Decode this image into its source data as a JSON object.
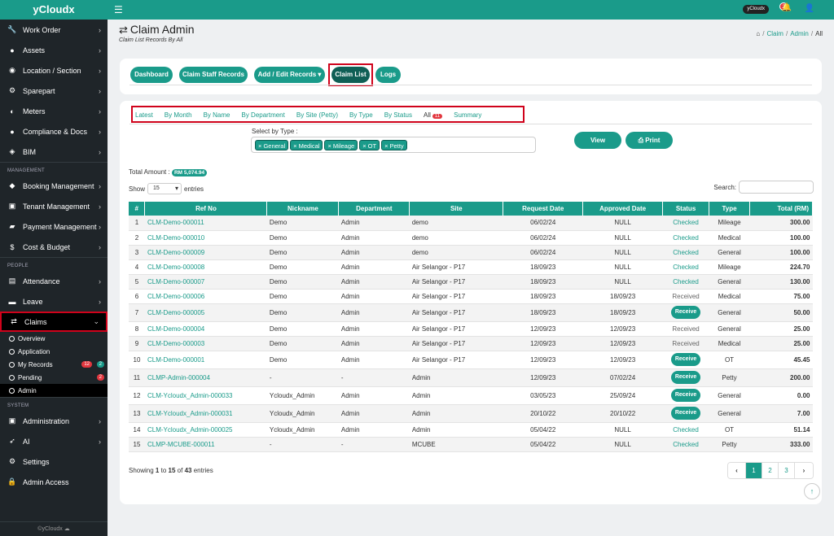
{
  "brand": "yCloudx",
  "topbar": {
    "user_label": "yCloudx",
    "notif_count": "2"
  },
  "sidebar": {
    "items_top": [
      {
        "label": "Work Order",
        "icon": "wrench-icon",
        "glyph": "🔧"
      },
      {
        "label": "Assets",
        "icon": "tag-icon",
        "glyph": "●"
      },
      {
        "label": "Location / Section",
        "icon": "globe-icon",
        "glyph": "◉"
      },
      {
        "label": "Sparepart",
        "icon": "cog-icon",
        "glyph": "⚙"
      },
      {
        "label": "Meters",
        "icon": "dashboard-icon",
        "glyph": "◐"
      },
      {
        "label": "Compliance & Docs",
        "icon": "shield-icon",
        "glyph": "●"
      },
      {
        "label": "BIM",
        "icon": "cube-icon",
        "glyph": "◈"
      }
    ],
    "section_management": "MANAGEMENT",
    "items_management": [
      {
        "label": "Booking Management",
        "icon": "ticket-icon",
        "glyph": "◆"
      },
      {
        "label": "Tenant Management",
        "icon": "building-icon",
        "glyph": "▣"
      },
      {
        "label": "Payment Management",
        "icon": "cart-icon",
        "glyph": "▰"
      },
      {
        "label": "Cost & Budget",
        "icon": "dollar-icon",
        "glyph": "$"
      }
    ],
    "section_people": "PEOPLE",
    "items_people": [
      {
        "label": "Attendance",
        "icon": "calendar-icon",
        "glyph": "▤"
      },
      {
        "label": "Leave",
        "icon": "briefcase-icon",
        "glyph": "▬"
      }
    ],
    "claims": {
      "label": "Claims",
      "icon": "exchange-icon",
      "glyph": "⇄"
    },
    "claims_sub": [
      {
        "label": "Overview"
      },
      {
        "label": "Application"
      },
      {
        "label": "My Records",
        "badge_red": "12",
        "badge_green": "2"
      },
      {
        "label": "Pending",
        "badge_red": "2"
      },
      {
        "label": "Admin"
      }
    ],
    "section_system": "SYSTEM",
    "items_system": [
      {
        "label": "Administration",
        "icon": "id-card-icon",
        "glyph": "▣"
      },
      {
        "label": "AI",
        "icon": "rocket-icon",
        "glyph": "➶"
      },
      {
        "label": "Settings",
        "icon": "gear-icon",
        "glyph": "⚙"
      },
      {
        "label": "Admin Access",
        "icon": "lock-icon",
        "glyph": "🔒"
      }
    ],
    "footer": "©yCloudx ☁"
  },
  "page": {
    "title": "Claim Admin",
    "subtitle": "Claim List Records By All",
    "breadcrumb": [
      "Claim",
      "Admin",
      "All"
    ]
  },
  "toolbar": {
    "dashboard": "Dashboard",
    "staff_records": "Claim Staff Records",
    "add_edit": "Add / Edit Records ▾",
    "claim_list": "Claim List",
    "logs": "Logs"
  },
  "tabs": {
    "latest": "Latest",
    "by_month": "By Month",
    "by_name": "By Name",
    "by_department": "By Department",
    "by_site": "By Site (Petty)",
    "by_type": "By Type",
    "by_status": "By Status",
    "all": "All",
    "all_count": "11",
    "summary": "Summary"
  },
  "filter": {
    "label": "Select by Type :",
    "chips": [
      "× General",
      "× Medical",
      "× Mileage",
      "× OT",
      "× Petty"
    ]
  },
  "actions": {
    "view": "View",
    "print": "Print"
  },
  "total": {
    "label": "Total Amount :",
    "value": "RM 5,074.94"
  },
  "show": {
    "prefix": "Show",
    "value": "15",
    "suffix": "entries"
  },
  "search": {
    "label": "Search:"
  },
  "table": {
    "headers": [
      "#",
      "Ref No",
      "Nickname",
      "Department",
      "Site",
      "Request Date",
      "Approved Date",
      "Status",
      "Type",
      "Total (RM)"
    ],
    "rows": [
      [
        "1",
        "CLM-Demo-000011",
        "Demo",
        "Admin",
        "demo",
        "06/02/24",
        "NULL",
        "Checked",
        "Mileage",
        "300.00"
      ],
      [
        "2",
        "CLM-Demo-000010",
        "Demo",
        "Admin",
        "demo",
        "06/02/24",
        "NULL",
        "Checked",
        "Medical",
        "100.00"
      ],
      [
        "3",
        "CLM-Demo-000009",
        "Demo",
        "Admin",
        "demo",
        "06/02/24",
        "NULL",
        "Checked",
        "General",
        "100.00"
      ],
      [
        "4",
        "CLM-Demo-000008",
        "Demo",
        "Admin",
        "Air Selangor - P17",
        "18/09/23",
        "NULL",
        "Checked",
        "Mileage",
        "224.70"
      ],
      [
        "5",
        "CLM-Demo-000007",
        "Demo",
        "Admin",
        "Air Selangor - P17",
        "18/09/23",
        "NULL",
        "Checked",
        "General",
        "130.00"
      ],
      [
        "6",
        "CLM-Demo-000006",
        "Demo",
        "Admin",
        "Air Selangor - P17",
        "18/09/23",
        "18/09/23",
        "Received",
        "Medical",
        "75.00"
      ],
      [
        "7",
        "CLM-Demo-000005",
        "Demo",
        "Admin",
        "Air Selangor - P17",
        "18/09/23",
        "18/09/23",
        "Receive",
        "General",
        "50.00"
      ],
      [
        "8",
        "CLM-Demo-000004",
        "Demo",
        "Admin",
        "Air Selangor - P17",
        "12/09/23",
        "12/09/23",
        "Received",
        "General",
        "25.00"
      ],
      [
        "9",
        "CLM-Demo-000003",
        "Demo",
        "Admin",
        "Air Selangor - P17",
        "12/09/23",
        "12/09/23",
        "Received",
        "Medical",
        "25.00"
      ],
      [
        "10",
        "CLM-Demo-000001",
        "Demo",
        "Admin",
        "Air Selangor - P17",
        "12/09/23",
        "12/09/23",
        "Receive",
        "OT",
        "45.45"
      ],
      [
        "11",
        "CLMP-Admin-000004",
        "-",
        "-",
        "Admin",
        "12/09/23",
        "07/02/24",
        "Receive",
        "Petty",
        "200.00"
      ],
      [
        "12",
        "CLM-Ycloudx_Admin-000033",
        "Ycloudx_Admin",
        "Admin",
        "Admin",
        "03/05/23",
        "25/09/24",
        "Receive",
        "General",
        "0.00"
      ],
      [
        "13",
        "CLM-Ycloudx_Admin-000031",
        "Ycloudx_Admin",
        "Admin",
        "Admin",
        "20/10/22",
        "20/10/22",
        "Receive",
        "General",
        "7.00"
      ],
      [
        "14",
        "CLM-Ycloudx_Admin-000025",
        "Ycloudx_Admin",
        "Admin",
        "Admin",
        "05/04/22",
        "NULL",
        "Checked",
        "OT",
        "51.14"
      ],
      [
        "15",
        "CLMP-MCUBE-000011",
        "-",
        "-",
        "MCUBE",
        "05/04/22",
        "NULL",
        "Checked",
        "Petty",
        "333.00"
      ]
    ]
  },
  "showing": {
    "prefix": "Showing",
    "from": "1",
    "to_word": "to",
    "to": "15",
    "of_word": "of",
    "total": "43",
    "suffix": "entries"
  },
  "pager": [
    "1",
    "2",
    "3"
  ],
  "colors": {
    "accent": "#1a9b8a",
    "sidebar": "#1f2529",
    "highlight": "#d0021b"
  }
}
